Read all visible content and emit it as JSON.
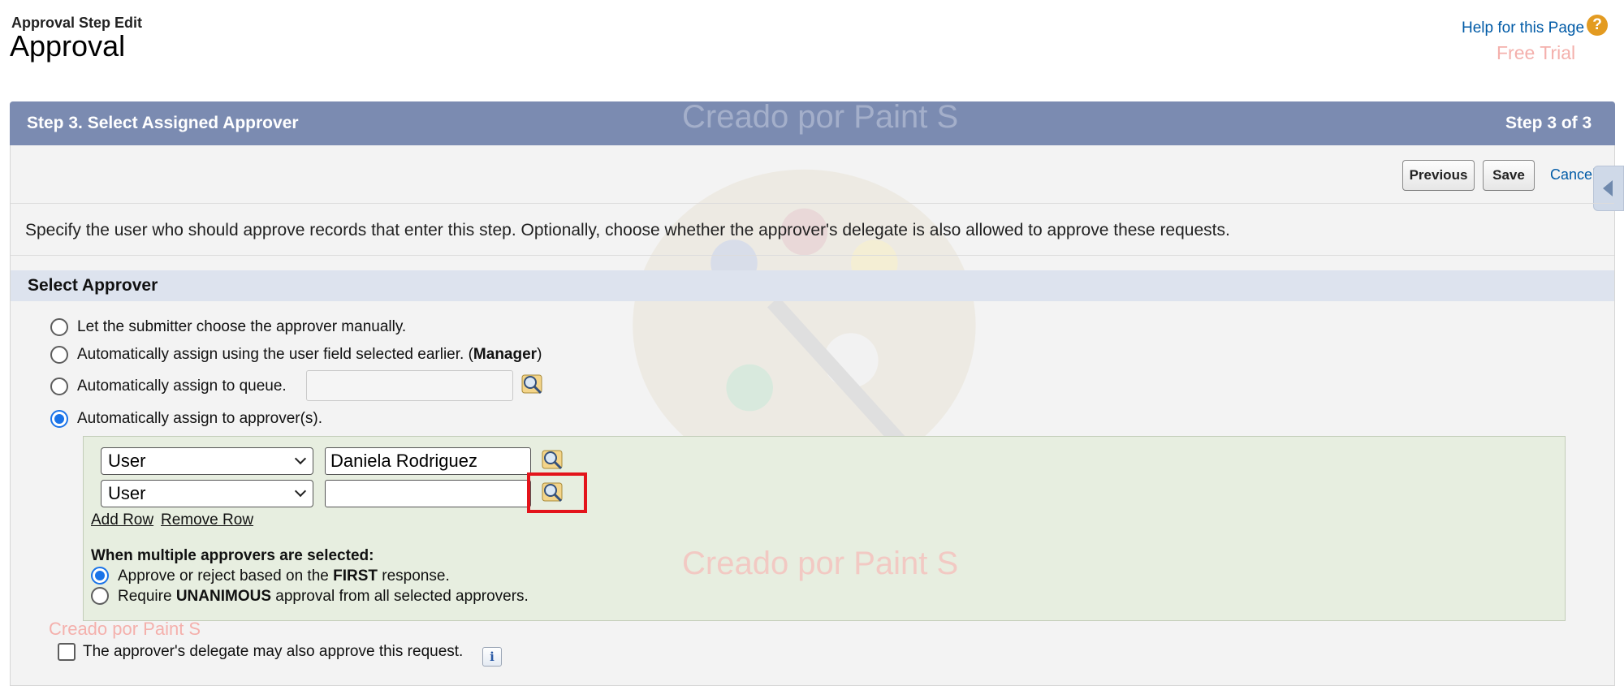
{
  "header": {
    "subtitle": "Approval Step Edit",
    "title": "Approval",
    "help_link": "Help for this Page",
    "help_icon": "?",
    "watermark_trial": "Free Trial"
  },
  "step": {
    "title": "Step 3. Select Assigned Approver",
    "count": "Step 3 of 3"
  },
  "buttons": {
    "previous": "Previous",
    "save": "Save",
    "cancel": "Cancel"
  },
  "description": "Specify the user who should approve records that enter this step. Optionally, choose whether the approver's delegate is also allowed to approve these requests.",
  "section": {
    "title": "Select Approver",
    "options": [
      {
        "label": "Let the submitter choose the approver manually.",
        "selected": false
      },
      {
        "label_prefix": "Automatically assign using the user field selected earlier. (",
        "label_bold": "Manager",
        "label_suffix": ")",
        "selected": false
      },
      {
        "label": "Automatically assign to queue.",
        "selected": false,
        "input_value": ""
      },
      {
        "label": "Automatically assign to approver(s).",
        "selected": true
      }
    ]
  },
  "approvers": {
    "rows": [
      {
        "type": "User",
        "value": "Daniela Rodriguez"
      },
      {
        "type": "User",
        "value": ""
      }
    ],
    "add_row": "Add Row",
    "remove_row": "Remove Row",
    "multi_title": "When multiple approvers are selected:",
    "multi_options": [
      {
        "prefix": "Approve or reject based on the ",
        "bold": "FIRST",
        "suffix": " response.",
        "selected": true
      },
      {
        "prefix": "Require ",
        "bold": "UNANIMOUS",
        "suffix": " approval from all selected approvers.",
        "selected": false
      }
    ]
  },
  "delegate": {
    "label": "The approver's delegate may also approve this request.",
    "checked": false,
    "info_icon": "i"
  },
  "watermarks": {
    "center_top": "Creado por Paint S",
    "center_bottom": "Creado por Paint S",
    "bottom_left": "Creado por Paint S"
  },
  "icons": {
    "lookup": "lookup-magnifier-icon",
    "help": "help-circle-icon",
    "info": "info-icon",
    "side_tab": "chevron-left-icon"
  },
  "colors": {
    "step_bar": "#7b8bb1",
    "link": "#015ba7",
    "approver_box": "#e7eee0",
    "highlight": "#e3141b",
    "radio_selected": "#1a73e8"
  }
}
